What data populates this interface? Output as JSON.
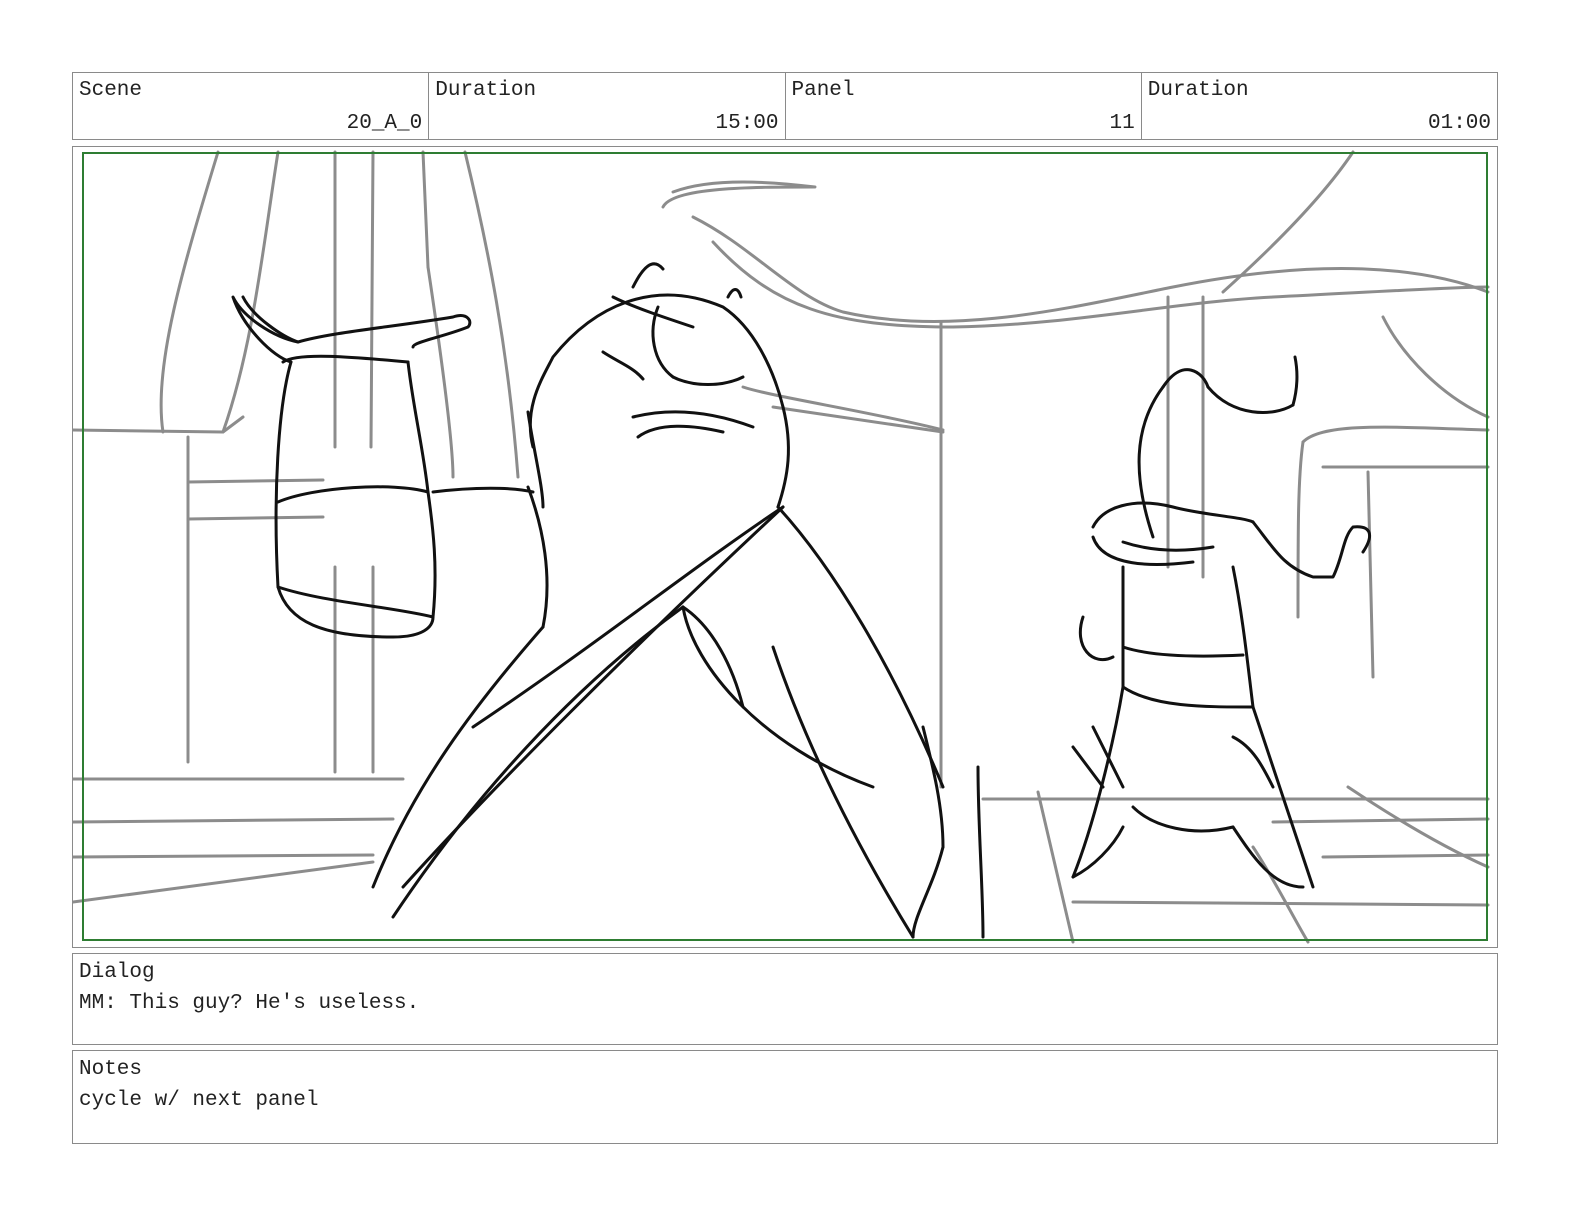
{
  "header": {
    "scene_label": "Scene",
    "scene_value": "20_A_0",
    "scene_duration_label": "Duration",
    "scene_duration_value": "15:00",
    "panel_label": "Panel",
    "panel_value": "11",
    "panel_duration_label": "Duration",
    "panel_duration_value": "01:00"
  },
  "frame": {
    "safe_area_color": "#2e7d32",
    "sketch_light_color": "#8c8c8c",
    "sketch_dark_color": "#111111"
  },
  "dialog": {
    "label": "Dialog",
    "text": "MM: This guy? He's useless."
  },
  "notes": {
    "label": "Notes",
    "text": "cycle w/ next panel"
  }
}
